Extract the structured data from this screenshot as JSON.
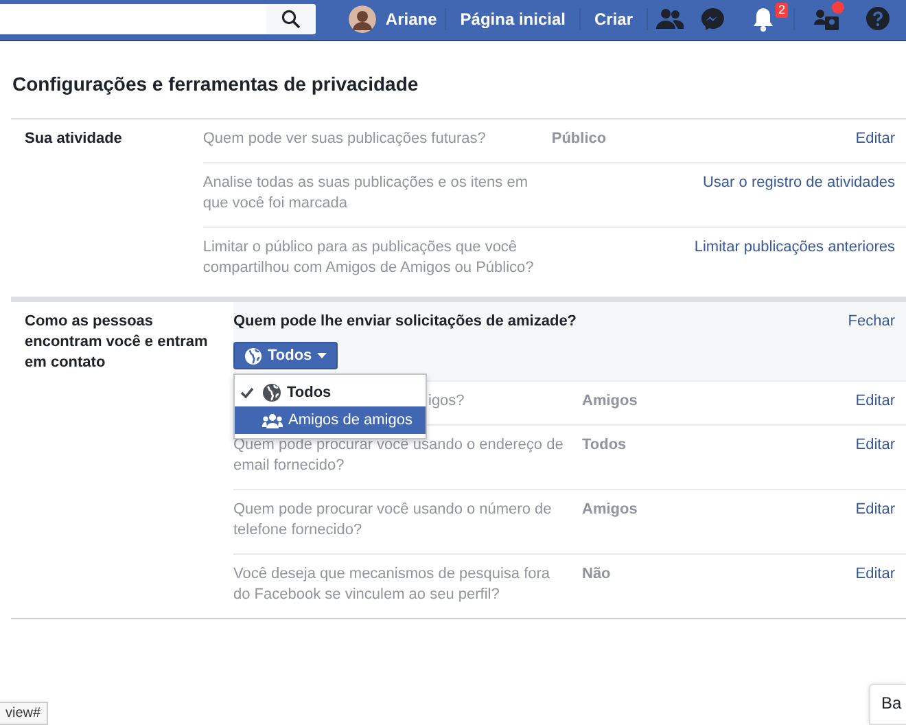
{
  "topbar": {
    "user_name": "Ariane",
    "nav": [
      "Página inicial",
      "Criar"
    ],
    "notifications_badge": "2",
    "friend_requests_dot": true
  },
  "page_title": "Configurações e ferramentas de privacidade",
  "sections": [
    {
      "label": "Sua atividade",
      "rows": [
        {
          "kind": "row",
          "question": "Quem pode ver suas publicações futuras?",
          "value": "Público",
          "action": "Editar"
        },
        {
          "kind": "row",
          "question": "Analise todas as suas publicações e os itens em que você foi marcada",
          "action": "Usar o registro de atividades"
        },
        {
          "kind": "row",
          "question": "Limitar o público para as publicações que você compartilhou com Amigos de Amigos ou Público?",
          "action": "Limitar publicações anteriores"
        }
      ]
    },
    {
      "label": "Como as pessoas encontram você e entram em contato",
      "editor": {
        "question": "Quem pode lhe enviar solicitações de amizade?",
        "action": "Fechar",
        "selector": {
          "label": "Todos",
          "expanded": true,
          "options": [
            {
              "label": "Todos",
              "kind": "globe",
              "selected": true,
              "highlighted": false
            },
            {
              "label": "Amigos de amigos",
              "kind": "friends",
              "selected": false,
              "highlighted": true
            }
          ]
        }
      },
      "rows": [
        {
          "kind": "covered",
          "question": "igos?",
          "value": "Amigos",
          "action": "Editar"
        },
        {
          "kind": "row",
          "question": "Quem pode procurar você usando o endereço de email fornecido?",
          "value": "Todos",
          "action": "Editar"
        },
        {
          "kind": "row",
          "question": "Quem pode procurar você usando o número de telefone fornecido?",
          "value": "Amigos",
          "action": "Editar"
        },
        {
          "kind": "row",
          "question": "Você deseja que mecanismos de pesquisa fora do Facebook se vinculem ao seu perfil?",
          "value": "Não",
          "action": "Editar"
        }
      ]
    }
  ],
  "status_url": "view#",
  "chat_tab": "Ba"
}
